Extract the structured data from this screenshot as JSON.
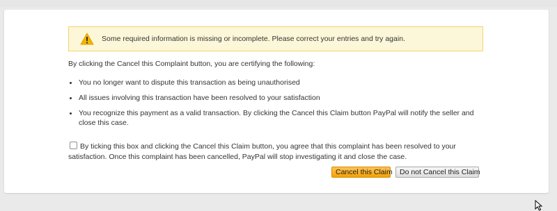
{
  "alert": {
    "icon": "warning-icon",
    "message": "Some required information is missing or incomplete. Please correct your entries and try again."
  },
  "intro": "By clicking the Cancel this Complaint button, you are certifying the following:",
  "bullets": [
    "You no longer want to dispute this transaction as being unauthorised",
    "All issues involving this transaction have been resolved to your satisfaction",
    "You recognize this payment as a valid transaction. By clicking the Cancel this Claim button PayPal will notify the seller and close this case."
  ],
  "agreement": {
    "checked": false,
    "text": "By ticking this box and clicking the Cancel this Claim button, you agree that this complaint has been resolved to your satisfaction. Once this complaint has been cancelled, PayPal will stop investigating it and close the case."
  },
  "buttons": {
    "cancel_claim": "Cancel this Claim",
    "do_not_cancel": "Do not Cancel this Claim"
  },
  "colors": {
    "alert_background": "#fdf7d9",
    "alert_border": "#f0d56a",
    "primary_button": "#f5a200"
  }
}
